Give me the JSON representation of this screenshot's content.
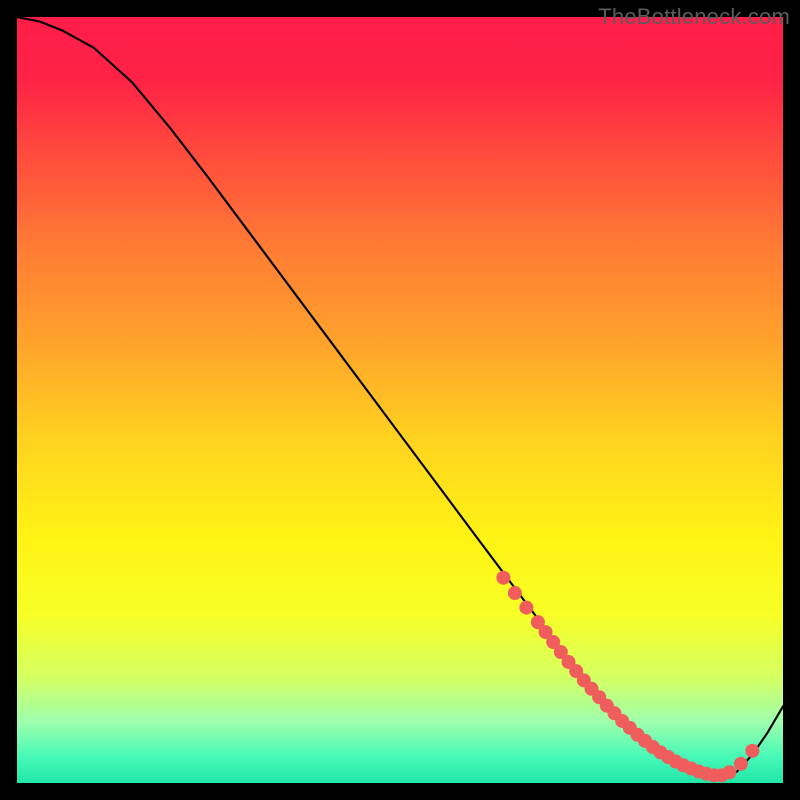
{
  "watermark": "TheBottleneck.com",
  "chart_data": {
    "type": "line",
    "title": "",
    "xlabel": "",
    "ylabel": "",
    "xlim": [
      0,
      100
    ],
    "ylim": [
      0,
      100
    ],
    "grid": false,
    "series": [
      {
        "name": "curve",
        "x": [
          0,
          3,
          6,
          10,
          15,
          20,
          25,
          30,
          35,
          40,
          45,
          50,
          55,
          60,
          63,
          66,
          69,
          72,
          75,
          78,
          80,
          82,
          84,
          86,
          88,
          90,
          92,
          94,
          96,
          98,
          100
        ],
        "y": [
          100,
          99.4,
          98.2,
          96,
          91.5,
          85.5,
          79,
          72.3,
          65.6,
          58.9,
          52.2,
          45.5,
          38.8,
          32.1,
          28.1,
          24.1,
          20.1,
          16.1,
          12.3,
          8.8,
          6.7,
          4.9,
          3.4,
          2.2,
          1.3,
          0.7,
          0.5,
          1.5,
          3.7,
          6.6,
          10
        ]
      }
    ],
    "annotations": {
      "dots": {
        "name": "scatter-points",
        "x": [
          63.5,
          65,
          66.5,
          68,
          69,
          70,
          71,
          72,
          73,
          74,
          75,
          76,
          77,
          78,
          79,
          80,
          81,
          82,
          83,
          84,
          85,
          86,
          87,
          88,
          89,
          90,
          91,
          92,
          93,
          94.5,
          96
        ],
        "y": [
          26.8,
          24.8,
          22.9,
          21,
          19.7,
          18.4,
          17.1,
          15.8,
          14.6,
          13.4,
          12.3,
          11.2,
          10.1,
          9.1,
          8.1,
          7.2,
          6.3,
          5.5,
          4.7,
          4,
          3.4,
          2.8,
          2.3,
          1.9,
          1.5,
          1.2,
          1,
          1,
          1.4,
          2.5,
          4.2
        ]
      }
    },
    "background_gradient": {
      "stops": [
        {
          "offset": 0.0,
          "color": "#ff1d49"
        },
        {
          "offset": 0.08,
          "color": "#ff2246"
        },
        {
          "offset": 0.18,
          "color": "#ff4b3d"
        },
        {
          "offset": 0.3,
          "color": "#ff7b34"
        },
        {
          "offset": 0.42,
          "color": "#ffa12c"
        },
        {
          "offset": 0.55,
          "color": "#ffd21f"
        },
        {
          "offset": 0.68,
          "color": "#fff314"
        },
        {
          "offset": 0.78,
          "color": "#f7ff26"
        },
        {
          "offset": 0.86,
          "color": "#d6ff60"
        },
        {
          "offset": 0.92,
          "color": "#9effac"
        },
        {
          "offset": 0.965,
          "color": "#48f9b7"
        },
        {
          "offset": 1.0,
          "color": "#20e7a8"
        }
      ]
    },
    "curve_color": "#000000",
    "dot_color": "#ef5d5d",
    "dot_radius": 7
  }
}
